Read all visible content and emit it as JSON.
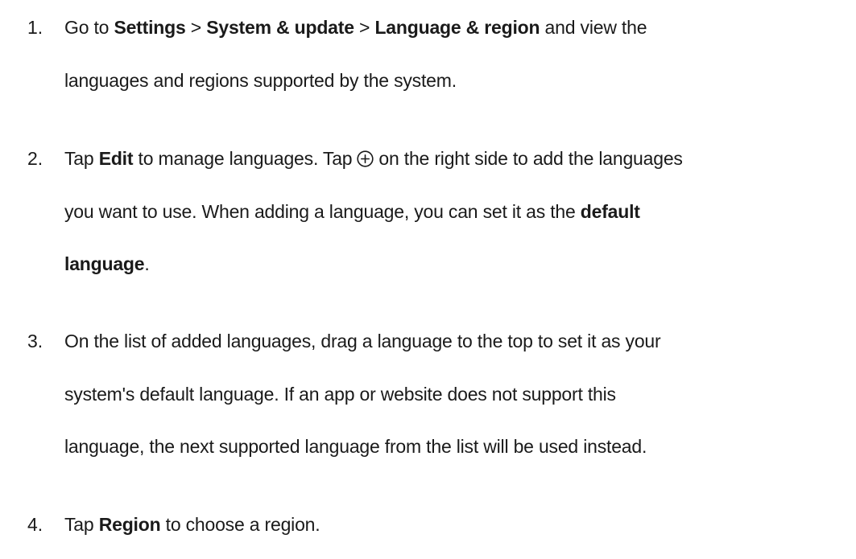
{
  "steps": [
    {
      "number": "1.",
      "lines": [
        [
          "Go to ",
          {
            "b": "Settings"
          },
          " > ",
          {
            "b": "System & update"
          },
          " > ",
          {
            "b": "Language & region"
          },
          " and view the"
        ],
        [
          "languages and regions supported by the system."
        ]
      ]
    },
    {
      "number": "2.",
      "lines": [
        [
          "Tap ",
          {
            "b": "Edit"
          },
          " to manage languages. Tap",
          {
            "icon": "plus-circle-icon"
          },
          "on the right side to add the languages"
        ],
        [
          "you want to use. When adding a language, you can set it as the ",
          {
            "b": "default"
          }
        ],
        [
          {
            "b": "language"
          },
          "."
        ]
      ]
    },
    {
      "number": "3.",
      "lines": [
        [
          "On the list of added languages, drag a language to the top to set it as your"
        ],
        [
          "system's default language. If an app or website does not support this"
        ],
        [
          "language, the next supported language from the list will be used instead."
        ]
      ]
    },
    {
      "number": "4.",
      "lines": [
        [
          "Tap ",
          {
            "b": "Region"
          },
          " to choose a region."
        ]
      ]
    }
  ]
}
